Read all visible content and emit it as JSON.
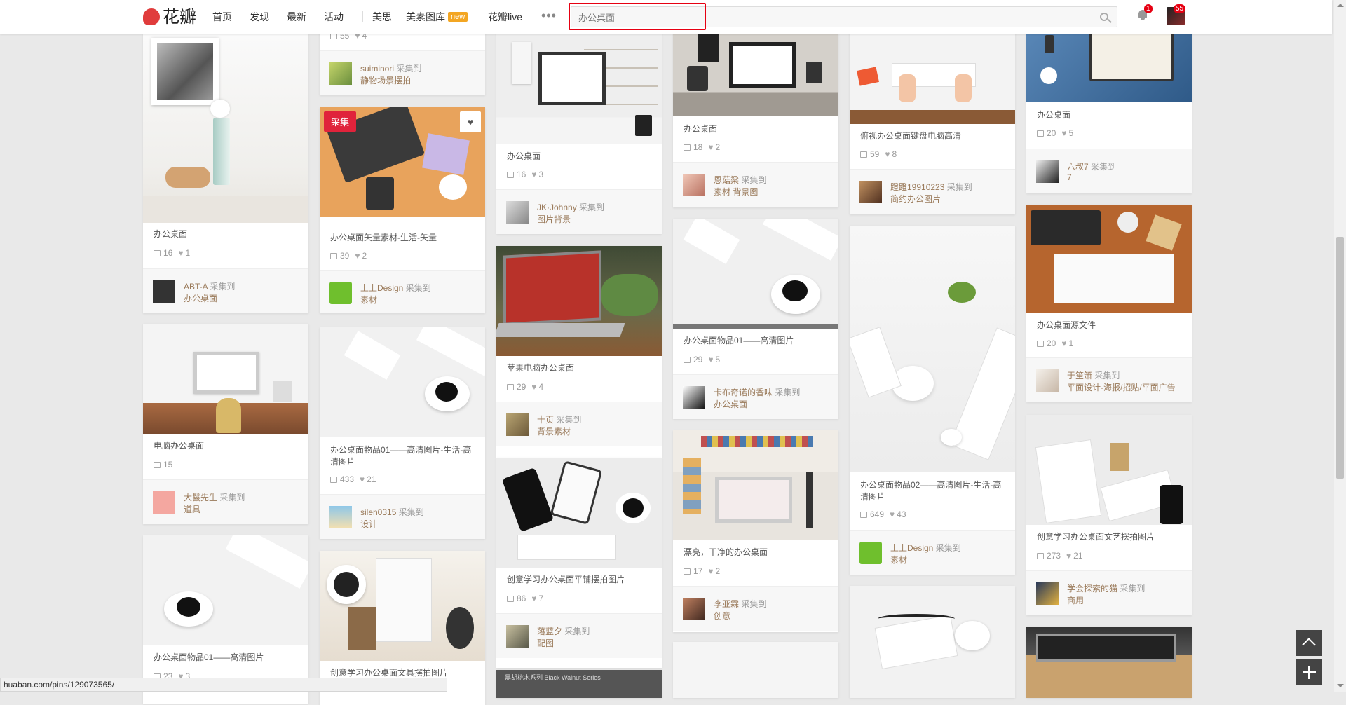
{
  "header": {
    "logo_text": "花瓣",
    "nav": [
      "首页",
      "发现",
      "最新",
      "活动"
    ],
    "nav2": [
      "美思",
      "美素图库",
      "花瓣live"
    ],
    "new_badge": "new",
    "search_placeholder": "办公桌面",
    "notify_count": "1",
    "message_count": "55"
  },
  "status_url": "huaban.com/pins/129073565/",
  "columns": [
    [
      {
        "title": "办公桌面",
        "repins": "16",
        "likes": "1",
        "user": "ABT-A",
        "board": "办公桌面"
      },
      {
        "title": "电脑办公桌面",
        "repins": "15",
        "likes": "",
        "user": "大鬣先生",
        "board": "道具"
      },
      {
        "title": "办公桌面物品01——高清图片",
        "repins": "23",
        "likes": "3",
        "user": "",
        "board": ""
      }
    ],
    [
      {
        "title": "",
        "repins": "55",
        "likes": "4",
        "user": "suiminori",
        "board": "静物场景摆拍"
      },
      {
        "title": "办公桌面矢量素材-生活-矢量",
        "repins": "39",
        "likes": "2",
        "user": "上上Design",
        "board": "素材"
      },
      {
        "title": "办公桌面物品01——高清图片-生活-高清图片",
        "repins": "433",
        "likes": "21",
        "user": "silen0315",
        "board": "设计"
      },
      {
        "title": "创意学习办公桌面文具摆拍图片",
        "repins": "",
        "likes": "",
        "user": "",
        "board": ""
      }
    ],
    [
      {
        "title": "办公桌面",
        "repins": "16",
        "likes": "3",
        "user": "JK·Johnny",
        "board": "图片背景"
      },
      {
        "title": "苹果电脑办公桌面",
        "repins": "29",
        "likes": "4",
        "user": "十页",
        "board": "背景素材"
      },
      {
        "title": "创意学习办公桌面平铺摆拍图片",
        "repins": "86",
        "likes": "7",
        "user": "落蓝夕",
        "board": "配图"
      }
    ],
    [
      {
        "title": "办公桌面",
        "repins": "18",
        "likes": "2",
        "user": "恩菇梁",
        "board": "素材 背景图"
      },
      {
        "title": "办公桌面物品01——高清图片",
        "repins": "29",
        "likes": "5",
        "user": "卡布奇诺的香味",
        "board": "办公桌面"
      },
      {
        "title": "漂亮，干净的办公桌面",
        "repins": "17",
        "likes": "2",
        "user": "李亚霖",
        "board": "创意"
      }
    ],
    [
      {
        "title": "俯视办公桌面键盘电脑高清",
        "repins": "59",
        "likes": "8",
        "user": "蹬蹬19910223",
        "board": "简约办公图片"
      },
      {
        "title": "办公桌面物品02——高清图片-生活-高清图片",
        "repins": "649",
        "likes": "43",
        "user": "上上Design",
        "board": "素材"
      }
    ],
    [
      {
        "title": "办公桌面",
        "repins": "20",
        "likes": "5",
        "user": "六叔7",
        "board": "7"
      },
      {
        "title": "办公桌面源文件",
        "repins": "20",
        "likes": "1",
        "user": "于笙箫",
        "board": "平面设计-海报/招贴/平面广告"
      },
      {
        "title": "创意学习办公桌面文艺摆拍图片",
        "repins": "273",
        "likes": "21",
        "user": "学会探索的猫",
        "board": "商用"
      }
    ]
  ],
  "labels": {
    "collected_to": "采集到",
    "collect": "采集",
    "like_icon": "heart-icon"
  },
  "image_caption_text": "黑胡桃木系列 Black Walnut Series"
}
